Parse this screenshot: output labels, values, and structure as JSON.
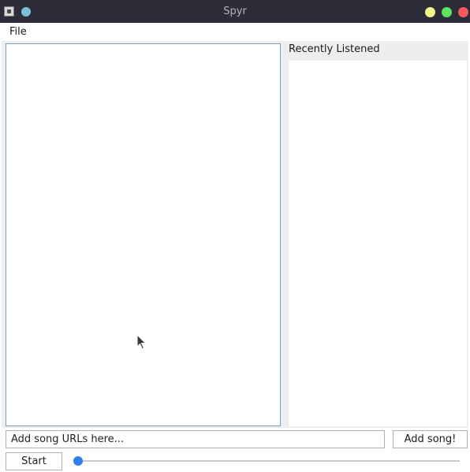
{
  "window": {
    "title": "Spyr"
  },
  "menu": {
    "file": "File"
  },
  "recently_listened": {
    "title": "Recently Listened",
    "items": []
  },
  "song_input": {
    "value": "Add song URLs here...",
    "add_button": "Add song!"
  },
  "player": {
    "start_button": "Start",
    "progress_fraction": 0.0
  },
  "colors": {
    "titlebar_bg": "#2d2d3a",
    "minimize": "#f3f58a",
    "maximize": "#5ee35e",
    "close": "#f4595e",
    "slider_thumb": "#2f80ed"
  },
  "icons": {
    "app": "java-app-icon",
    "sticky": "sticky-dot-icon",
    "cursor": "mouse-pointer-icon"
  }
}
